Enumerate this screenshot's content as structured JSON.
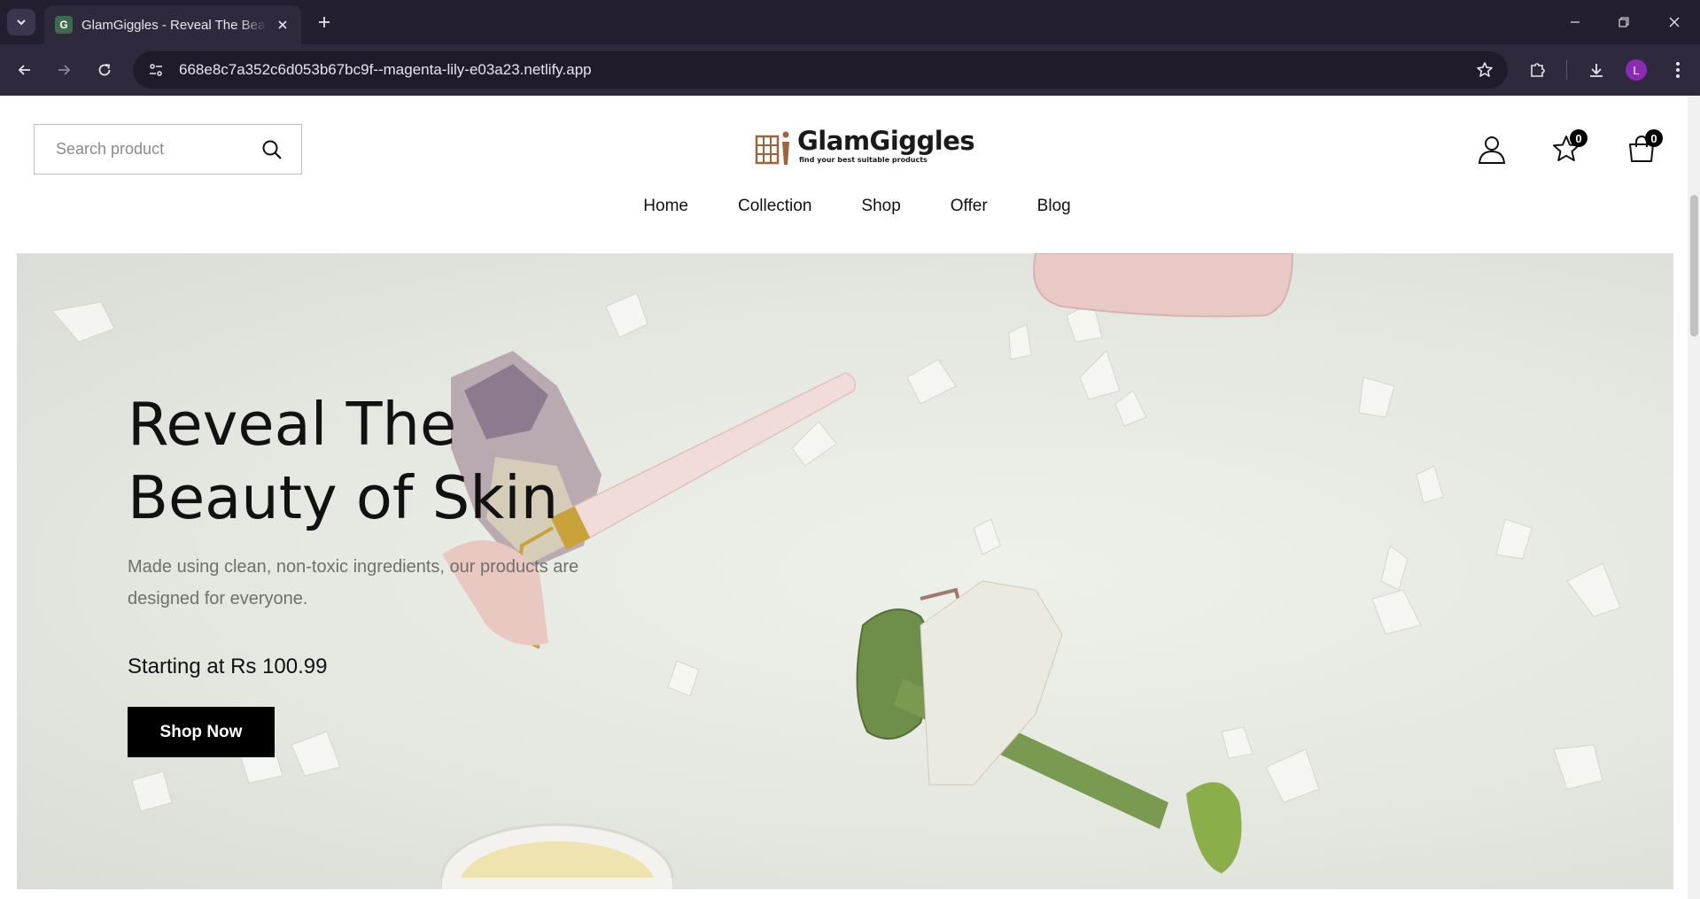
{
  "browser": {
    "tab_title": "GlamGiggles - Reveal The Beauty of Skin",
    "favicon_letter": "G",
    "url": "668e8c7a352c6d053b67bc9f--magenta-lily-e03a23.netlify.app",
    "profile_initial": "L",
    "profile_color": "#8a2bb3"
  },
  "header": {
    "search": {
      "placeholder": "Search product"
    },
    "logo": {
      "name": "GlamGiggles",
      "tagline": "find your best suitable products"
    },
    "wishlist_count": "0",
    "cart_count": "0"
  },
  "nav": {
    "items": [
      "Home",
      "Collection",
      "Shop",
      "Offer",
      "Blog"
    ]
  },
  "hero": {
    "title_line1": "Reveal The",
    "title_line2": "Beauty of Skin",
    "subtitle": "Made using clean, non-toxic ingredients, our products are designed for everyone.",
    "price_text": "Starting at Rs 100.99",
    "cta_label": "Shop Now"
  },
  "colors": {
    "chrome_dark": "#231e30",
    "hero_bg": "#e4e7e0",
    "cta_bg": "#000000",
    "logo_accent": "#a0643c"
  }
}
